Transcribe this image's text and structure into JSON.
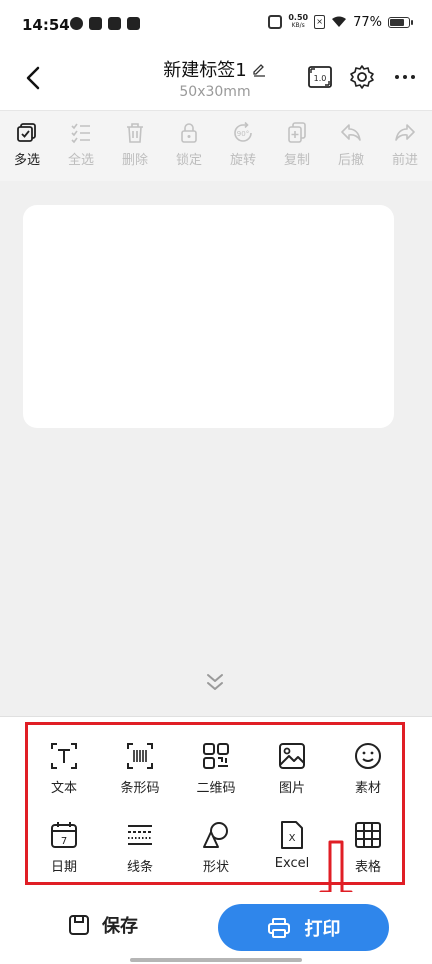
{
  "status_bar": {
    "time": "14:54",
    "net_speed_value": "0.50",
    "net_speed_unit": "KB/s",
    "battery": "77%"
  },
  "header": {
    "title": "新建标签1",
    "subtitle": "50x30mm",
    "zoom_label": "1.0"
  },
  "toolbar": {
    "items": [
      {
        "label": "多选",
        "icon": "multi-select-icon",
        "enabled": true
      },
      {
        "label": "全选",
        "icon": "select-all-icon",
        "enabled": false
      },
      {
        "label": "删除",
        "icon": "delete-icon",
        "enabled": false
      },
      {
        "label": "锁定",
        "icon": "lock-icon",
        "enabled": false
      },
      {
        "label": "旋转",
        "icon": "rotate-icon",
        "enabled": false,
        "badge": "90°"
      },
      {
        "label": "复制",
        "icon": "copy-icon",
        "enabled": false
      },
      {
        "label": "后撤",
        "icon": "undo-icon",
        "enabled": false
      },
      {
        "label": "前进",
        "icon": "redo-icon",
        "enabled": false
      }
    ]
  },
  "elements": {
    "items": [
      {
        "label": "文本",
        "icon": "text-icon"
      },
      {
        "label": "条形码",
        "icon": "barcode-icon"
      },
      {
        "label": "二维码",
        "icon": "qrcode-icon"
      },
      {
        "label": "图片",
        "icon": "image-icon"
      },
      {
        "label": "素材",
        "icon": "emoji-icon"
      },
      {
        "label": "日期",
        "icon": "calendar-icon",
        "badge": "7"
      },
      {
        "label": "线条",
        "icon": "lines-icon"
      },
      {
        "label": "形状",
        "icon": "shapes-icon"
      },
      {
        "label": "Excel",
        "icon": "excel-icon",
        "badge": "X"
      },
      {
        "label": "表格",
        "icon": "table-icon"
      }
    ]
  },
  "bottom": {
    "save_label": "保存",
    "print_label": "打印"
  },
  "colors": {
    "accent": "#2f86eb",
    "highlight": "#e01e25"
  }
}
